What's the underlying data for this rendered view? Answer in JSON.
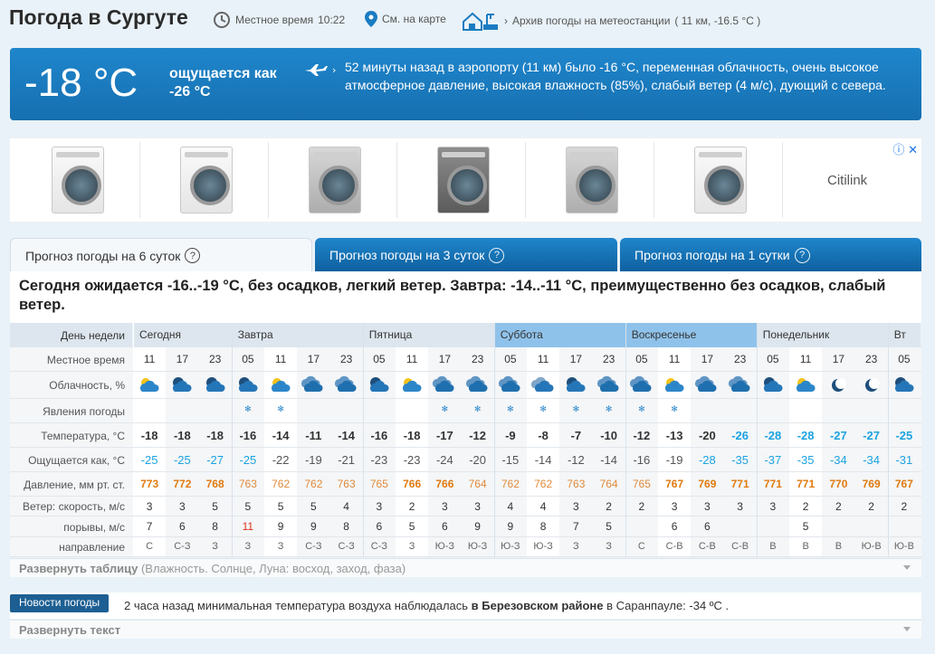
{
  "header": {
    "title": "Погода в Сургуте",
    "local_time_label": "Местное время",
    "local_time": "10:22",
    "map_link": "См. на карте",
    "archive_link": "Архив погоды на метеостанции",
    "archive_meta": "( 11 км, -16.5 °C )"
  },
  "current": {
    "temp": "-18 °C",
    "feels_like": "ощущается как -26 °C",
    "note": "52 минуты назад в аэропорту (11 км) было -16 °C, переменная облачность, очень высокое атмосферное давление, высокая влажность (85%), слабый ветер (4 м/с), дующий с севера."
  },
  "ad": {
    "brand": "Citilink",
    "info_close": "ⓘ ✕",
    "products": [
      "washing-machine",
      "washing-machine",
      "washing-machine",
      "washing-machine",
      "washing-machine",
      "washing-machine"
    ]
  },
  "tabs": [
    {
      "label": "Прогноз погоды на 6 суток",
      "q": "?"
    },
    {
      "label": "Прогноз погоды на 3 суток",
      "q": "?"
    },
    {
      "label": "Прогноз погоды на 1 сутки",
      "q": "?"
    }
  ],
  "summary": "Сегодня ожидается -16..-19 °C, без осадков, легкий ветер. Завтра: -14..-11 °C, преимущественно без осадков, слабый ветер.",
  "table": {
    "row_labels": {
      "day": "День недели",
      "time": "Местное время",
      "cloud": "Облачность, %",
      "phen": "Явления погоды",
      "temp": "Температура, °C",
      "feels": "Ощущается как, °C",
      "press": "Давление, мм рт. ст.",
      "wind": "Ветер: скорость, м/с",
      "gust": "порывы, м/с",
      "dir": "направление"
    },
    "days": [
      {
        "name": "Сегодня",
        "cols": 3,
        "highlight": false
      },
      {
        "name": "Завтра",
        "cols": 4,
        "highlight": false
      },
      {
        "name": "Пятница",
        "cols": 4,
        "highlight": false
      },
      {
        "name": "Суббота",
        "cols": 4,
        "highlight": true
      },
      {
        "name": "Воскресенье",
        "cols": 4,
        "highlight": true
      },
      {
        "name": "Понедельник",
        "cols": 4,
        "highlight": false
      },
      {
        "name": "Вт",
        "cols": 1,
        "highlight": false
      }
    ],
    "times": [
      "11",
      "17",
      "23",
      "05",
      "11",
      "17",
      "23",
      "05",
      "11",
      "17",
      "23",
      "05",
      "11",
      "17",
      "23",
      "05",
      "11",
      "17",
      "23",
      "05",
      "11",
      "17",
      "23",
      "05"
    ],
    "cloud_icons": [
      "partly-cloudy",
      "cloudy-night",
      "cloudy-night",
      "cloudy-night",
      "partly-cloudy",
      "cloudy",
      "cloudy",
      "cloudy-night",
      "partly-sunny",
      "cloudy",
      "cloudy",
      "cloudy",
      "overcast",
      "cloudy-night",
      "cloudy",
      "cloudy",
      "partly-cloudy",
      "cloudy",
      "cloudy",
      "cloudy-night",
      "partly-sunny",
      "clear-night",
      "clear-night",
      "cloudy-night"
    ],
    "snow": [
      "",
      "",
      "",
      "✻",
      "✻",
      "",
      "",
      "",
      "",
      "✻",
      "✻",
      "✻",
      "✻",
      "✻",
      "✻",
      "✻",
      "✻",
      "",
      "",
      "",
      "",
      "",
      "",
      ""
    ],
    "temp": [
      "-18",
      "-18",
      "-18",
      "-16",
      "-14",
      "-11",
      "-14",
      "-16",
      "-18",
      "-17",
      "-12",
      "-9",
      "-8",
      "-7",
      "-10",
      "-12",
      "-13",
      "-20",
      "-26",
      "-28",
      "-28",
      "-27",
      "-27",
      "-25"
    ],
    "feels": [
      "-25",
      "-25",
      "-27",
      "-25",
      "-22",
      "-19",
      "-21",
      "-23",
      "-23",
      "-24",
      "-20",
      "-15",
      "-14",
      "-12",
      "-14",
      "-16",
      "-19",
      "-28",
      "-35",
      "-37",
      "-35",
      "-34",
      "-34",
      "-31"
    ],
    "press": [
      "773",
      "772",
      "768",
      "763",
      "762",
      "762",
      "763",
      "765",
      "766",
      "766",
      "764",
      "762",
      "762",
      "763",
      "764",
      "765",
      "767",
      "769",
      "771",
      "771",
      "771",
      "770",
      "769",
      "767"
    ],
    "wind": [
      "3",
      "3",
      "5",
      "5",
      "5",
      "5",
      "4",
      "3",
      "2",
      "3",
      "3",
      "4",
      "4",
      "3",
      "2",
      "2",
      "3",
      "3",
      "3",
      "3",
      "2",
      "2",
      "2",
      "2"
    ],
    "gust": [
      "7",
      "6",
      "8",
      "11",
      "9",
      "9",
      "8",
      "6",
      "5",
      "6",
      "9",
      "9",
      "8",
      "7",
      "5",
      "",
      "6",
      "6",
      "",
      "",
      "5",
      "",
      "",
      ""
    ],
    "dir": [
      "С",
      "С-З",
      "З",
      "З",
      "З",
      "С-З",
      "С-З",
      "С-З",
      "З",
      "Ю-З",
      "Ю-З",
      "Ю-З",
      "Ю-З",
      "З",
      "З",
      "С",
      "С-В",
      "С-В",
      "С-В",
      "В",
      "В",
      "В",
      "Ю-В",
      "Ю-В"
    ],
    "colors": {
      "temp_cold": "#1ba3e0",
      "press_high": "#e07a10",
      "gust_strong": "#e0301a"
    }
  },
  "expand_table": {
    "label": "Развернуть таблицу",
    "hint": "(Влажность. Солнце, Луна: восход, заход, фаза)"
  },
  "news": {
    "tag": "Новости погоды",
    "text_pre": "2 часа назад минимальная температура воздуха наблюдалась ",
    "text_bold": "в Березовском районе",
    "text_post": " в Саранпауле: -34 ºC ."
  },
  "expand_text": {
    "label": "Развернуть текст"
  }
}
